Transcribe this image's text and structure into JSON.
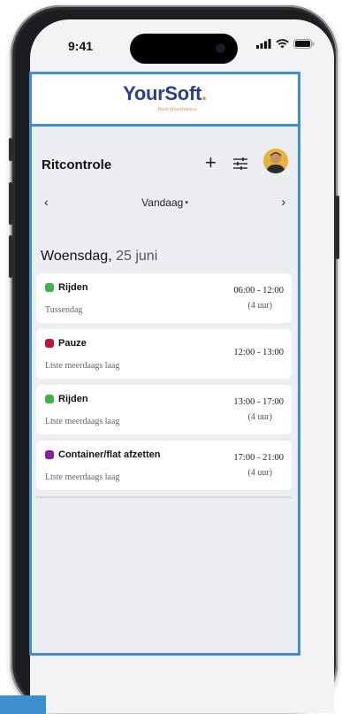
{
  "status_bar": {
    "time": "9:41"
  },
  "brand": {
    "name_main": "YourSoft",
    "name_dot": ".",
    "tagline": "Bedrijfssoftware"
  },
  "header": {
    "title": "Ritcontrole",
    "add_label": "+"
  },
  "date_nav": {
    "prev": "‹",
    "label": "Vandaag",
    "caret": "▾",
    "next": "›"
  },
  "day": {
    "weekday": "Woensdag,",
    "date": "25 juni"
  },
  "entries": [
    {
      "name": "Rijden",
      "subtitle": "Tussendag",
      "time": "06:00 - 12:00",
      "duration": "(4 uur)",
      "color": "#3bb54a"
    },
    {
      "name": "Pauze",
      "subtitle": "Ltste meerdaags laag",
      "time": "12:00 - 13:00",
      "duration": "",
      "color": "#c8102e"
    },
    {
      "name": "Rijden",
      "subtitle": "Ltste meerdaags laag",
      "time": "13:00 - 17:00",
      "duration": "(4 uur)",
      "color": "#3bb54a"
    },
    {
      "name": "Container/flat afzetten",
      "subtitle": "Ltste meerdaags laag",
      "time": "17:00 - 21:00",
      "duration": "(4 uur)",
      "color": "#8a1ca8"
    }
  ],
  "colors": {
    "frame_border": "#3d8fcf",
    "brand_blue": "#2c3e8f",
    "brand_orange": "#f08a24"
  }
}
